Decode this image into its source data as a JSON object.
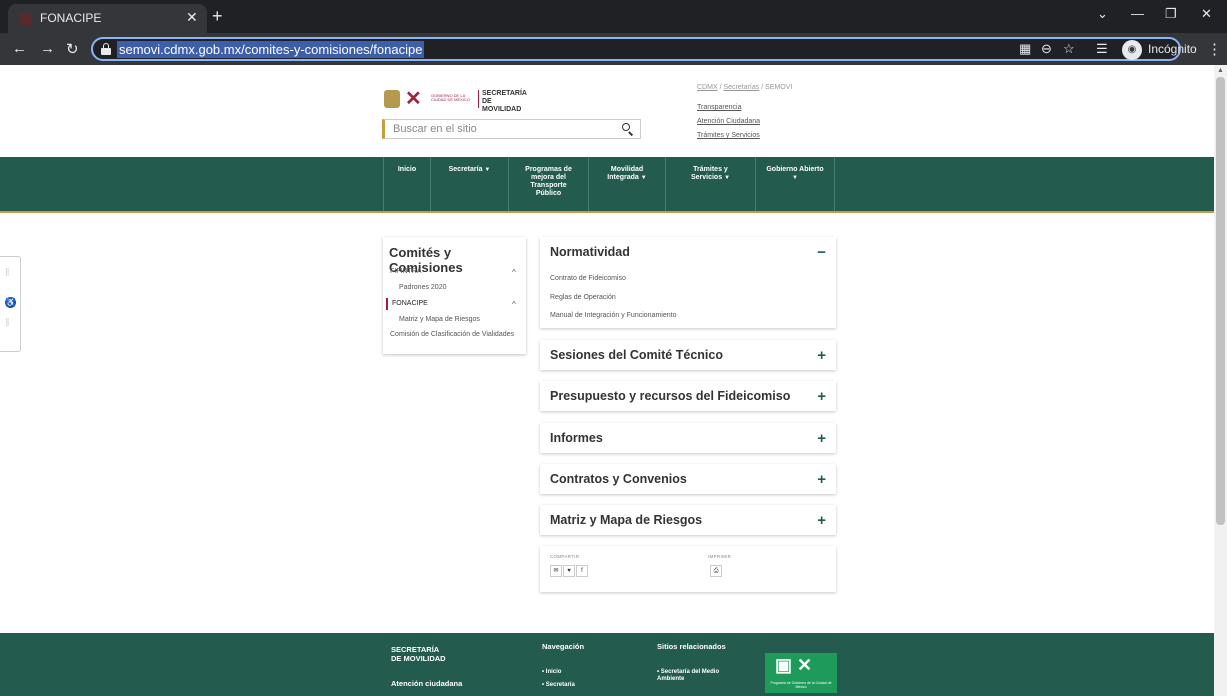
{
  "browser": {
    "tab_title": "FONACIPE",
    "url": "semovi.cdmx.gob.mx/comites-y-comisiones/fonacipe",
    "profile_label": "Incógnito"
  },
  "header": {
    "logo_gov": "GOBIERNO DE LA CIUDAD DE MÉXICO",
    "logo_secretaria": "SECRETARÍA",
    "logo_movilidad": "DE MOVILIDAD",
    "search_placeholder": "Buscar en el sitio",
    "breadcrumb": {
      "cdmx": "CDMX",
      "secretarias": "Secretarías",
      "current": "SEMOVI",
      "sep": " / "
    },
    "links": [
      "Transparencia",
      "Atención Ciudadana",
      "Trámites y Servicios"
    ]
  },
  "nav": [
    {
      "label": "Inicio",
      "has_chevron": false
    },
    {
      "label": "Secretaría",
      "has_chevron": true
    },
    {
      "label": "Programas de mejora del Transporte Público",
      "has_chevron": false
    },
    {
      "label": "Movilidad Integrada",
      "has_chevron": true
    },
    {
      "label": "Trámites y Servicios",
      "has_chevron": true
    },
    {
      "label": "Gobierno Abierto",
      "has_chevron": true
    }
  ],
  "sidebar": {
    "title": "Comités y Comisiones",
    "items": [
      {
        "label": "FIFINTRA"
      },
      {
        "label": "Padrones 2020"
      },
      {
        "label": "FONACIPE"
      },
      {
        "label": "Matriz y Mapa de Riesgos"
      },
      {
        "label": "Comisión de Clasificación de Vialidades"
      }
    ]
  },
  "accordions": [
    {
      "title": "Normatividad",
      "toggle": "−",
      "expanded": true,
      "links": [
        "Contrato de Fideicomiso",
        "Reglas de Operación",
        "Manual de Integración y Funcionamiento"
      ]
    },
    {
      "title": "Sesiones del Comité Técnico",
      "toggle": "+"
    },
    {
      "title": "Presupuesto y recursos del Fideicomiso",
      "toggle": "+"
    },
    {
      "title": "Informes",
      "toggle": "+"
    },
    {
      "title": "Contratos y Convenios",
      "toggle": "+"
    },
    {
      "title": "Matriz y Mapa de Riesgos",
      "toggle": "+"
    }
  ],
  "share": {
    "share_label": "COMPARTIR",
    "print_label": "IMPRIMIR"
  },
  "footer": {
    "secretaria": "SECRETARÍA",
    "movilidad": "DE MOVILIDAD",
    "atencion": "Atención ciudadana",
    "nav_head": "Navegación",
    "nav_links": [
      "Inicio",
      "Secretaría"
    ],
    "related_head": "Sitios relacionados",
    "related_links": [
      "Secretaría del Medio Ambiente"
    ],
    "badge_text": "Programa de Gobierno de la Ciudad de México"
  },
  "colors": {
    "brand_green": "#235b4e",
    "brand_gold": "#c79c45",
    "brand_wine": "#9f2241"
  }
}
